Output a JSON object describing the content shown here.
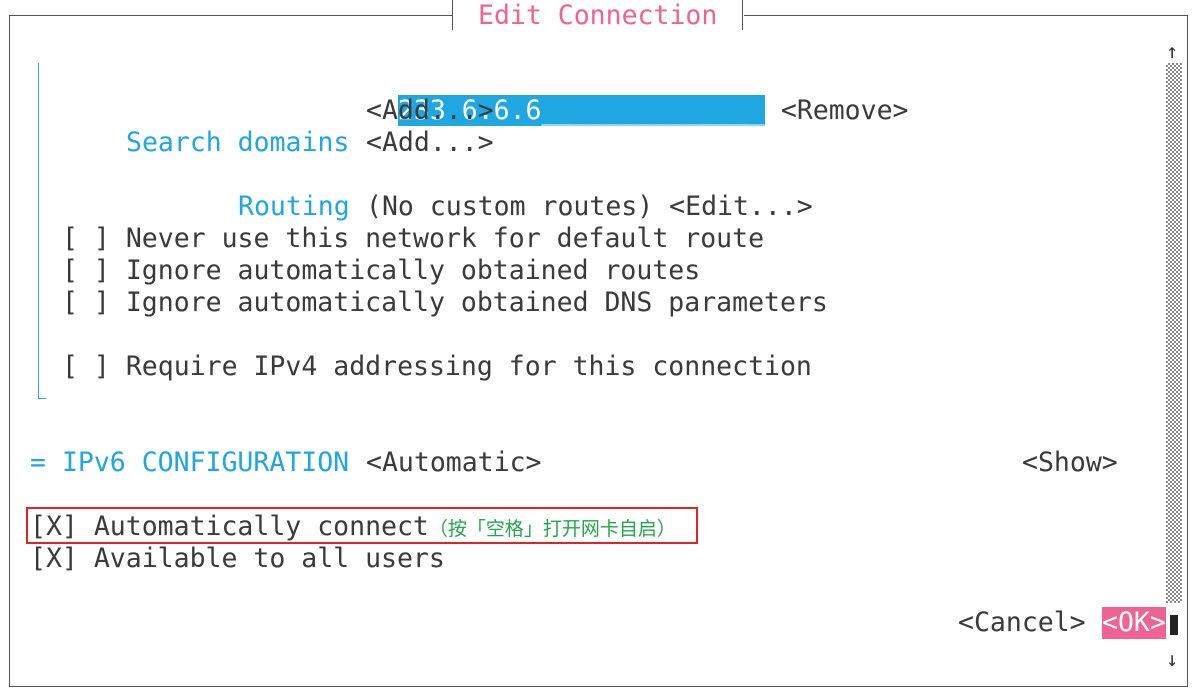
{
  "dialog": {
    "title": "Edit Connection"
  },
  "dns": {
    "server_value": "233.6.6.6",
    "server_blank": "______________",
    "remove_label": "<Remove>",
    "add_server_label": "<Add...>"
  },
  "search_domains": {
    "label": "Search domains",
    "add_label": "<Add...>"
  },
  "routing": {
    "label": "Routing",
    "value": "(No custom routes)",
    "edit_label": "<Edit...>"
  },
  "ipv4_options": [
    {
      "checkbox": "[ ]",
      "label": "Never use this network for default route"
    },
    {
      "checkbox": "[ ]",
      "label": "Ignore automatically obtained routes"
    },
    {
      "checkbox": "[ ]",
      "label": "Ignore automatically obtained DNS parameters"
    },
    {
      "checkbox": "[ ]",
      "label": "Require IPv4 addressing for this connection"
    }
  ],
  "ipv6": {
    "marker": "=",
    "label": "IPv6 CONFIGURATION",
    "mode": "<Automatic>",
    "show_label": "<Show>"
  },
  "connection_options": [
    {
      "checkbox": "[X]",
      "label": "Automatically connect",
      "note": "（按「空格」打开网卡自启）"
    },
    {
      "checkbox": "[X]",
      "label": "Available to all users"
    }
  ],
  "actions": {
    "cancel_label": "<Cancel>",
    "ok_label": "<OK>"
  },
  "scrollbar": {
    "up_arrow": "↑",
    "down_arrow": "↓"
  },
  "colors": {
    "accent_cyan": "#1ea7e1",
    "accent_pink": "#f06292",
    "annotation_red": "#e02424",
    "annotation_green": "#22a84a"
  }
}
